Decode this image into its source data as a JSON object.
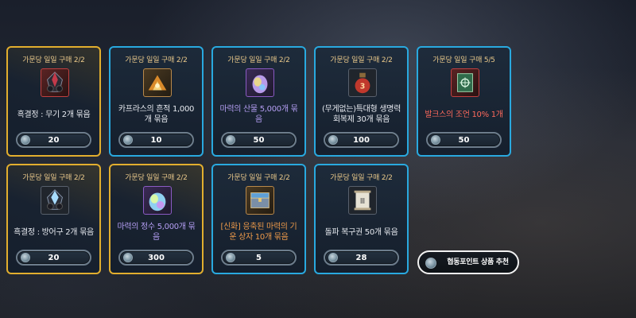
{
  "cards": [
    {
      "limit": "가문당 일일 구매 2/2",
      "name": "흑결정 : 무기 2개 묶음",
      "price": "20",
      "frame": "gold",
      "name_color": "white",
      "grade": "relic",
      "icon": "black-crystal-weapon-icon"
    },
    {
      "limit": "가문당 일일 구매 2/2",
      "name": "카프라스의 흔적 1,000개 묶음",
      "price": "10",
      "frame": "blue",
      "name_color": "white",
      "grade": "legend",
      "icon": "caphras-stone-icon"
    },
    {
      "limit": "가문당 일일 구매 2/2",
      "name": "마력의 산물 5,000개 묶음",
      "price": "50",
      "frame": "blue",
      "name_color": "purple",
      "grade": "epic",
      "icon": "magic-product-orb-icon"
    },
    {
      "limit": "가문당 일일 구매 2/2",
      "name": "(무게없는)특대형 생명력 회복제 30개 묶음",
      "price": "100",
      "frame": "blue",
      "name_color": "white",
      "grade": "normal",
      "icon": "hp-potion-icon"
    },
    {
      "limit": "가문당 일일 구매 5/5",
      "name": "발크스의 조언 10% 1개",
      "price": "50",
      "frame": "blue",
      "name_color": "red",
      "grade": "relic",
      "icon": "valks-advice-book-icon"
    },
    {
      "limit": "가문당 일일 구매 2/2",
      "name": "흑결정 : 방어구 2개 묶음",
      "price": "20",
      "frame": "gold",
      "name_color": "white",
      "grade": "normal",
      "icon": "black-crystal-armor-icon"
    },
    {
      "limit": "가문당 일일 구매 2/2",
      "name": "마력의 정수 5,000개 묶음",
      "price": "300",
      "frame": "gold",
      "name_color": "purple",
      "grade": "epic",
      "icon": "magic-essence-orb-icon"
    },
    {
      "limit": "가문당 일일 구매 2/2",
      "name": "[신화] 응축된 마력의 기운 상자 10개 묶음",
      "price": "5",
      "frame": "blue",
      "name_color": "orange",
      "grade": "legend",
      "icon": "condensed-magic-chest-icon"
    },
    {
      "limit": "가문당 일일 구매 2/2",
      "name": "돌파 복구권 50개 묶음",
      "price": "28",
      "frame": "blue",
      "name_color": "white",
      "grade": "normal",
      "icon": "breakthrough-scroll-icon"
    }
  ],
  "recommend_button": {
    "label": "협동포인트 상품 추천",
    "icon": "coop-point-coin-icon"
  },
  "colors": {
    "gold_frame": "#e2ae2e",
    "blue_frame": "#29a9df",
    "limit_text": "#e9c88a",
    "purple_text": "#b39df2",
    "orange_text": "#ee9a4a",
    "red_text": "#ff6a5c"
  }
}
